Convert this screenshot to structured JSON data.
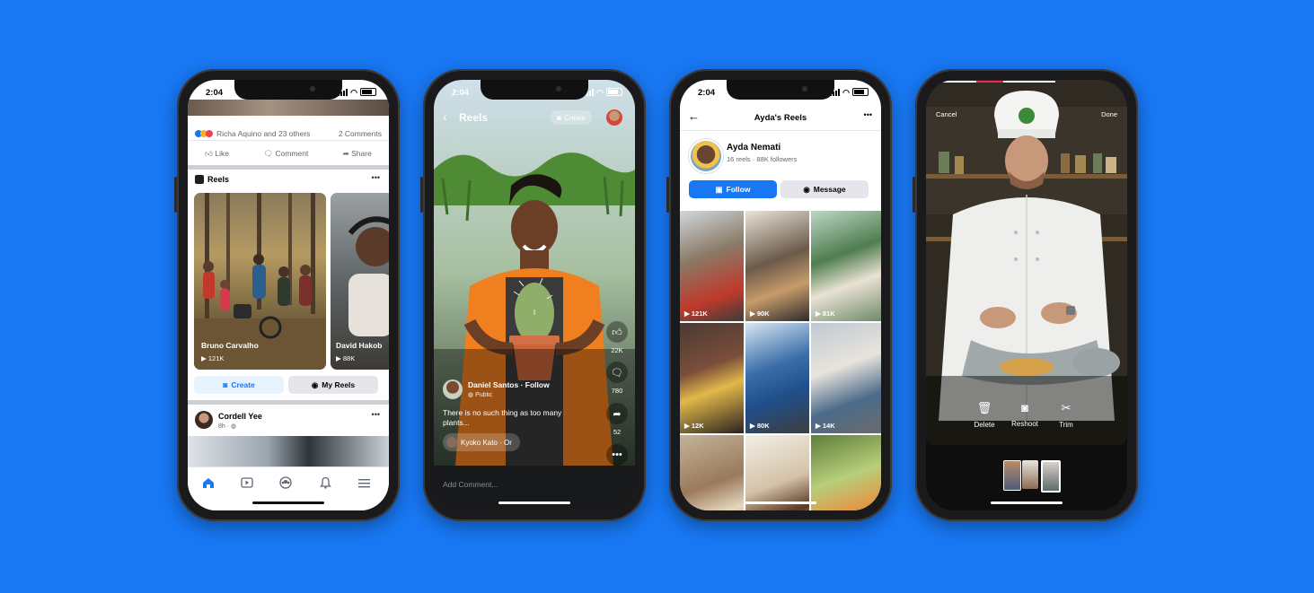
{
  "colors": {
    "background": "#1877f2",
    "accent": "#1877f2"
  },
  "phone1": {
    "time": "2:04",
    "reactions_text": "Richa Aquino and 23 others",
    "comments_count": "2 Comments",
    "actions": {
      "like": "Like",
      "comment": "Comment",
      "share": "Share"
    },
    "reels_header": "Reels",
    "more": "•••",
    "reels": [
      {
        "name": "Bruno Carvalho",
        "views": "121K"
      },
      {
        "name": "David Hakob",
        "views": "88K"
      }
    ],
    "create_label": "Create",
    "my_reels_label": "My Reels",
    "post": {
      "author": "Cordell Yee",
      "time": "8h ·"
    },
    "nav_icons": [
      "home-icon",
      "watch-icon",
      "groups-icon",
      "bell-icon",
      "menu-icon"
    ]
  },
  "phone2": {
    "time": "2:04",
    "title": "Reels",
    "create_label": "Create",
    "author": "Daniel Santos",
    "follow": "Follow",
    "privacy": "Public",
    "caption": "There is no such thing as too many plants...",
    "audio": "Kyoko Kato · Or",
    "like_count": "22K",
    "comment_count": "780",
    "share_count": "52",
    "add_comment_placeholder": "Add Comment..."
  },
  "phone3": {
    "time": "2:04",
    "title": "Ayda's Reels",
    "name": "Ayda Nemati",
    "stats": "16 reels · 88K followers",
    "follow_label": "Follow",
    "message_label": "Message",
    "grid": [
      {
        "views": "121K"
      },
      {
        "views": "90K"
      },
      {
        "views": "81K"
      },
      {
        "views": "12K"
      },
      {
        "views": "80K"
      },
      {
        "views": "14K"
      },
      {
        "views": ""
      },
      {
        "views": ""
      },
      {
        "views": ""
      }
    ]
  },
  "phone4": {
    "cancel": "Cancel",
    "done": "Done",
    "tools": {
      "delete": "Delete",
      "reshoot": "Reshoot",
      "trim": "Trim"
    }
  }
}
